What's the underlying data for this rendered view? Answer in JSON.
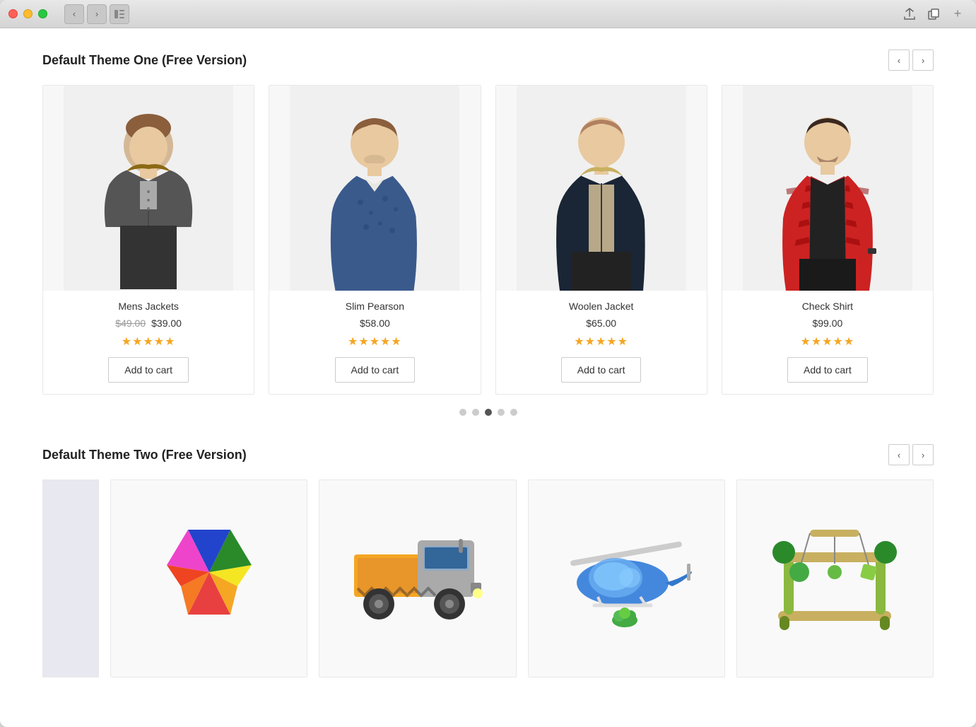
{
  "window": {
    "title": "Default Theme One (Free Version)"
  },
  "section1": {
    "title": "Default Theme One (Free Version)",
    "prev_label": "‹",
    "next_label": "›",
    "products": [
      {
        "id": "mens-jackets",
        "name": "Mens Jackets",
        "price_original": "$49.00",
        "price_current": "$39.00",
        "has_strikethrough": true,
        "stars": "★★★★★",
        "add_to_cart": "Add to cart",
        "bg_color": "#f0f0f0",
        "person_color": "#888"
      },
      {
        "id": "slim-pearson",
        "name": "Slim Pearson",
        "price_original": null,
        "price_current": "$58.00",
        "has_strikethrough": false,
        "stars": "★★★★★",
        "add_to_cart": "Add to cart",
        "bg_color": "#f0f0f0",
        "person_color": "#6688aa"
      },
      {
        "id": "woolen-jacket",
        "name": "Woolen Jacket",
        "price_original": null,
        "price_current": "$65.00",
        "has_strikethrough": false,
        "stars": "★★★★★",
        "add_to_cart": "Add to cart",
        "bg_color": "#f0f0f0",
        "person_color": "#334"
      },
      {
        "id": "check-shirt",
        "name": "Check Shirt",
        "price_original": null,
        "price_current": "$99.00",
        "has_strikethrough": false,
        "stars": "★★★★★",
        "add_to_cart": "Add to cart",
        "bg_color": "#f0f0f0",
        "person_color": "#cc3333"
      }
    ],
    "dots": [
      {
        "active": false
      },
      {
        "active": false
      },
      {
        "active": true
      },
      {
        "active": false
      },
      {
        "active": false
      }
    ]
  },
  "section2": {
    "title": "Default Theme Two (Free Version)",
    "prev_label": "‹",
    "next_label": "›",
    "toys": [
      {
        "id": "partial",
        "type": "partial"
      },
      {
        "id": "puzzle",
        "name": "Colorful Puzzle",
        "type": "puzzle"
      },
      {
        "id": "truck",
        "name": "Dump Truck",
        "type": "truck"
      },
      {
        "id": "helicopter",
        "name": "Helicopter",
        "type": "helicopter"
      },
      {
        "id": "gym",
        "name": "Baby Gym",
        "type": "gym"
      }
    ]
  }
}
